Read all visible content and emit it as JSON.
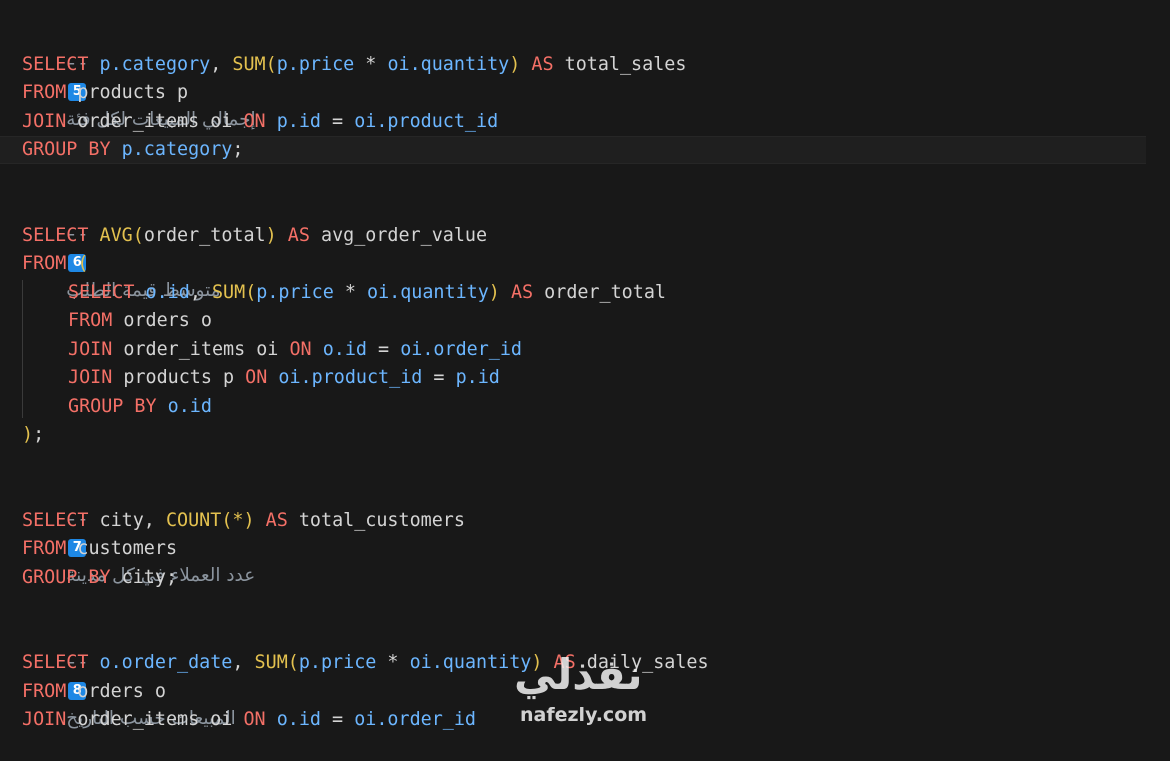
{
  "comments": {
    "c5": {
      "dash": "--",
      "badge": "5",
      "text": "إجمالي المبيعات لكل فئة"
    },
    "c6": {
      "dash": "--",
      "badge": "6",
      "text": "متوسط قيمة الطلب"
    },
    "c7": {
      "dash": "--",
      "badge": "7",
      "text": "عدد العملاء في كل مدينة"
    },
    "c8": {
      "dash": "--",
      "badge": "8",
      "text": "المبيعات حسب التاريخ"
    }
  },
  "code": {
    "l1": [
      "SELECT",
      " ",
      "p.category",
      ", ",
      "SUM",
      "(",
      "p.price",
      " * ",
      "oi.quantity",
      ")",
      " ",
      "AS",
      " total_sales"
    ],
    "l2": [
      "FROM",
      " products p"
    ],
    "l3": [
      "JOIN",
      " order_items oi ",
      "ON",
      " ",
      "p.id",
      " = ",
      "oi.product_id"
    ],
    "l4": [
      "GROUP BY",
      " ",
      "p.category",
      ";"
    ],
    "l6": [
      "SELECT",
      " ",
      "AVG",
      "(",
      "order_total",
      ")",
      " ",
      "AS",
      " avg_order_value"
    ],
    "l7": [
      "FROM",
      " ",
      "("
    ],
    "l8": [
      "SELECT",
      " ",
      "o.id",
      ", ",
      "SUM",
      "(",
      "p.price",
      " * ",
      "oi.quantity",
      ")",
      " ",
      "AS",
      " order_total"
    ],
    "l9": [
      "FROM",
      " orders o"
    ],
    "l10": [
      "JOIN",
      " order_items oi ",
      "ON",
      " ",
      "o.id",
      " = ",
      "oi.order_id"
    ],
    "l11": [
      "JOIN",
      " products p ",
      "ON",
      " ",
      "oi.product_id",
      " = ",
      "p.id"
    ],
    "l12": [
      "GROUP BY",
      " ",
      "o.id"
    ],
    "l13": [
      ")",
      ";"
    ],
    "l15": [
      "SELECT",
      " city, ",
      "COUNT",
      "(*)",
      " ",
      "AS",
      " total_customers"
    ],
    "l16": [
      "FROM",
      " customers"
    ],
    "l17": [
      "GROUP BY",
      " city;"
    ],
    "l19": [
      "SELECT",
      " ",
      "o.order_date",
      ", ",
      "SUM",
      "(",
      "p.price",
      " * ",
      "oi.quantity",
      ")",
      " ",
      "AS",
      " daily_sales"
    ],
    "l20": [
      "FROM",
      " orders o"
    ],
    "l21": [
      "JOIN",
      " order_items oi ",
      "ON",
      " ",
      "o.id",
      " = ",
      "oi.order_id"
    ]
  },
  "watermark": {
    "arabic": "نفذلي",
    "latin": "nafezly.com"
  },
  "colors": {
    "background": "#181818",
    "keyword": "#f47067",
    "function": "#e3c14f",
    "identifier": "#6cb6ff",
    "comment": "#8b949e",
    "badge": "#1e88e5"
  }
}
